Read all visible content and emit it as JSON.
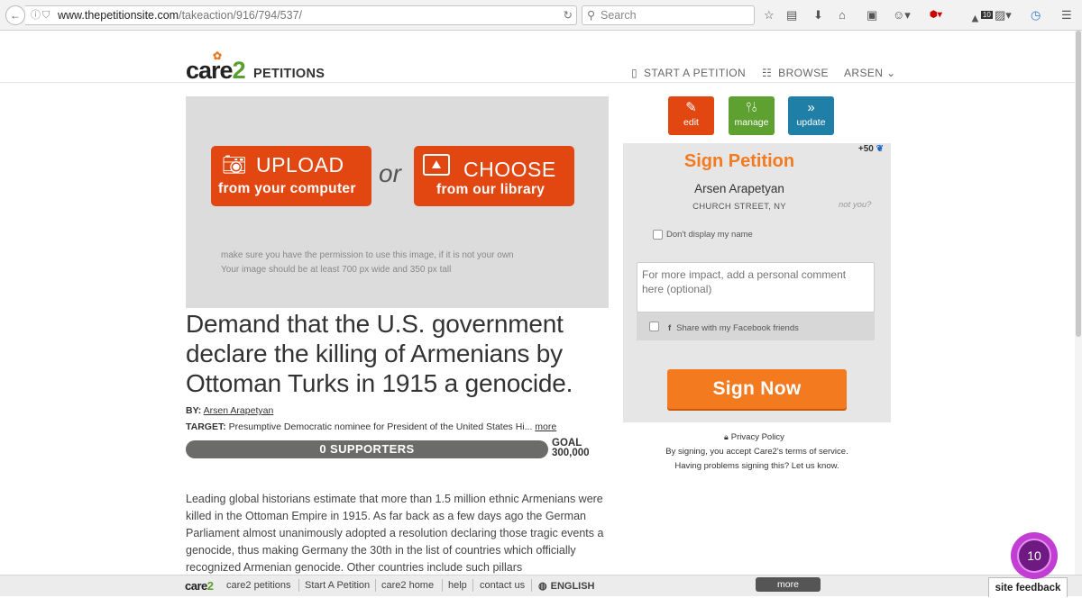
{
  "browser": {
    "url_domain": "www.thepetitionsite.com",
    "url_path": "/takeaction/916/794/537/",
    "search_placeholder": "Search",
    "notification_count": "10"
  },
  "header": {
    "logo": "care2",
    "logo_word": "PETITIONS",
    "nav_start": "START A PETITION",
    "nav_browse": "BROWSE",
    "nav_user": "ARSEN"
  },
  "image_area": {
    "upload_line1": "UPLOAD",
    "upload_line2": "from your computer",
    "or": "or",
    "choose_line1": "CHOOSE",
    "choose_line2": "from our library",
    "hint1": "make sure you have the permission to use this image, if it is not your own",
    "hint2": "Your image should be at least 700 px wide and 350 px tall"
  },
  "petition": {
    "title": "Demand that the U.S. government declare the killing of Armenians by Ottoman Turks in 1915 a genocide.",
    "by_label": "BY:",
    "author": "Arsen Arapetyan",
    "target_label": "TARGET:",
    "target": "Presumptive Democratic nominee for President of the United States Hi...",
    "more": "more",
    "supporters": "0 SUPPORTERS",
    "supporters_fraction": 0,
    "goal_label": "GOAL",
    "goal_value": "300,000",
    "body": "Leading global historians estimate that more than 1.5 million ethnic Armenians were killed in the Ottoman Empire in 1915. As far back as a few days ago the German Parliament almost unanimously adopted a resolution declaring those tragic events a genocide, thus making Germany the 30th in the list of countries which officially recognized Armenian genocide. Other countries include such pillars"
  },
  "actions": {
    "edit": "edit",
    "manage": "manage",
    "update": "update"
  },
  "sign": {
    "badge": "+50",
    "heading": "Sign Petition",
    "name": "Arsen Arapetyan",
    "address": "CHURCH STREET, NY",
    "not_you": "not you?",
    "dont_display": "Don't display my name",
    "comment_placeholder": "For more impact, add a personal comment here (optional)",
    "facebook_share": "Share with my Facebook friends",
    "button": "Sign Now",
    "privacy": "Privacy Policy",
    "terms": "By signing, you accept Care2's terms of service.",
    "problems": "Having problems signing this? Let us know."
  },
  "footer": {
    "logo": "care2",
    "links": [
      "care2 petitions",
      "Start A Petition",
      "care2 home",
      "help",
      "contact us"
    ],
    "language": "ENGLISH",
    "more": "more",
    "site_feedback": "site feedback",
    "bubble_count": "10"
  },
  "colors": {
    "orange": "#e24712",
    "sign_orange": "#f37a1f",
    "green": "#5ea131",
    "blue": "#1f7fa6"
  }
}
